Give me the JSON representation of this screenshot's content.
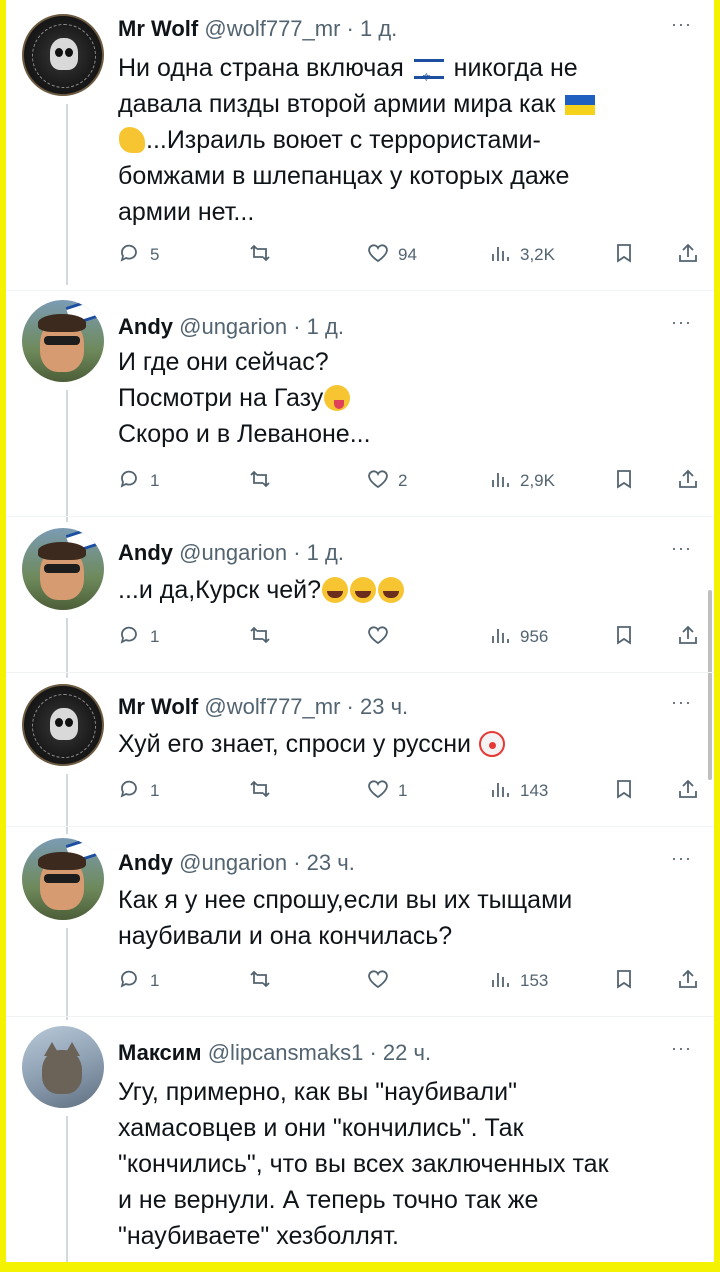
{
  "tweets": [
    {
      "name": "Mr Wolf",
      "handle": "@wolf777_mr",
      "time": "1 д.",
      "lines": [
        [
          "Ни одна страна включая ",
          "[flag-il]",
          " никогда не"
        ],
        [
          "давала пизды второй армии мира как ",
          "[flag-ua]"
        ],
        [
          "[muscle]",
          "...Израиль воюет с террористами-"
        ],
        [
          "бомжами в шлепанцах у которых даже"
        ],
        [
          "армии нет..."
        ]
      ],
      "replies": "5",
      "retweets": "",
      "likes": "94",
      "views": "3,2K"
    },
    {
      "name": "Andy",
      "handle": "@ungarion",
      "time": "1 д.",
      "lines": [
        [
          "И где они сейчас?"
        ],
        [
          "Посмотри на Газу",
          "[wink]"
        ],
        [
          "Скоро и в Леваноне..."
        ]
      ],
      "replies": "1",
      "retweets": "",
      "likes": "2",
      "views": "2,9K"
    },
    {
      "name": "Andy",
      "handle": "@ungarion",
      "time": "1 д.",
      "lines": [
        [
          "...и да,Курск чей?",
          "[laugh]",
          "[laugh]",
          "[laugh]"
        ]
      ],
      "replies": "1",
      "retweets": "",
      "likes": "",
      "views": "956"
    },
    {
      "name": "Mr Wolf",
      "handle": "@wolf777_mr",
      "time": "23 ч.",
      "lines": [
        [
          "Хуй его знает, спроси у руссни ",
          "[clown]"
        ]
      ],
      "replies": "1",
      "retweets": "",
      "likes": "1",
      "views": "143"
    },
    {
      "name": "Andy",
      "handle": "@ungarion",
      "time": "23 ч.",
      "lines": [
        [
          "Как я у нее спрошу,если вы их тыщами"
        ],
        [
          "наубивали и она кончилась?"
        ]
      ],
      "replies": "1",
      "retweets": "",
      "likes": "",
      "views": "153"
    },
    {
      "name": "Максим",
      "handle": "@lipcansmaks1",
      "time": "22 ч.",
      "lines": [
        [
          "Угу, примерно, как вы \"наубивали\""
        ],
        [
          "хамасовцев и они \"кончились\". Так"
        ],
        [
          "\"кончились\", что вы всех заключенных так"
        ],
        [
          "и не вернули. А теперь точно так же"
        ],
        [
          "\"наубиваете\" хезболлят."
        ]
      ],
      "replies": "",
      "retweets": "",
      "likes": "",
      "views": ""
    }
  ],
  "icons": {
    "reply": "reply-icon",
    "retweet": "retweet-icon",
    "like": "heart-icon",
    "views": "views-icon",
    "bookmark": "bookmark-icon",
    "share": "share-icon",
    "more": "more-icon"
  },
  "more_glyph": "···",
  "separator": " · "
}
